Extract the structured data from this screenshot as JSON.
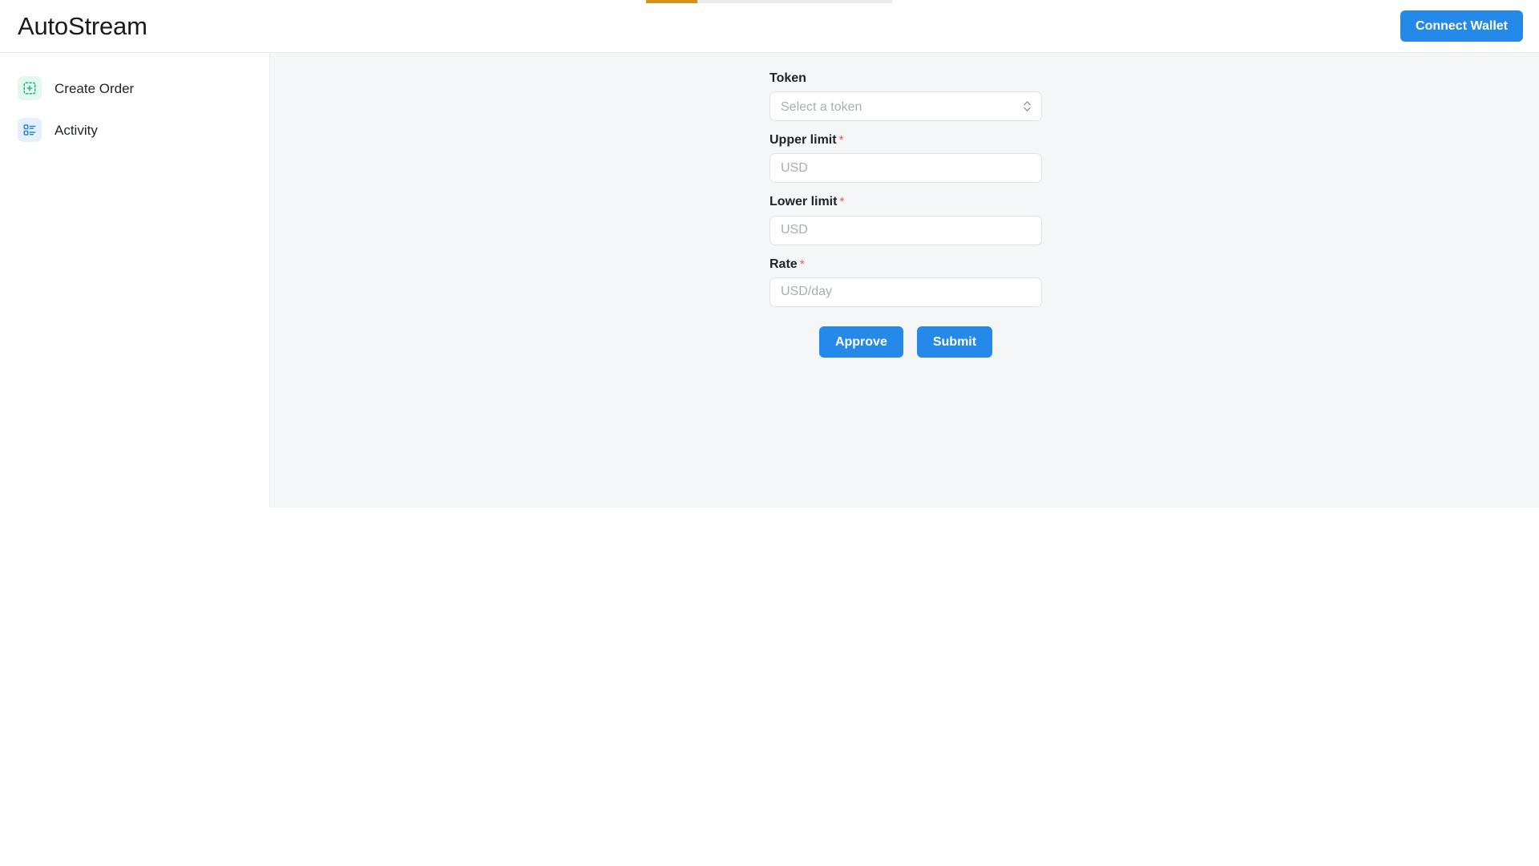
{
  "header": {
    "brand": "AutoStream",
    "connect_wallet_label": "Connect Wallet",
    "accent_color": "#2489e8"
  },
  "progress": {
    "icon": "loading-bar",
    "percent": 21,
    "fill_color": "#d99117",
    "track_color": "#e9eaec"
  },
  "sidebar": {
    "items": [
      {
        "label": "Create Order",
        "icon": "add-square-dashed-icon",
        "icon_color": "#1eb980",
        "icon_bg": "#e3f9ef",
        "active": true
      },
      {
        "label": "Activity",
        "icon": "list-layout-icon",
        "icon_color": "#2489e8",
        "icon_bg": "#e6f0fd",
        "active": false
      }
    ]
  },
  "form": {
    "token": {
      "label": "Token",
      "required": false,
      "placeholder": "Select a token",
      "value": "",
      "icon": "chevron-up-down-icon"
    },
    "upper_limit": {
      "label": "Upper limit",
      "required_mark": "*",
      "placeholder": "USD",
      "value": ""
    },
    "lower_limit": {
      "label": "Lower limit",
      "required_mark": "*",
      "placeholder": "USD",
      "value": ""
    },
    "rate": {
      "label": "Rate",
      "required_mark": "*",
      "placeholder": "USD/day",
      "value": ""
    },
    "approve_label": "Approve",
    "submit_label": "Submit"
  }
}
